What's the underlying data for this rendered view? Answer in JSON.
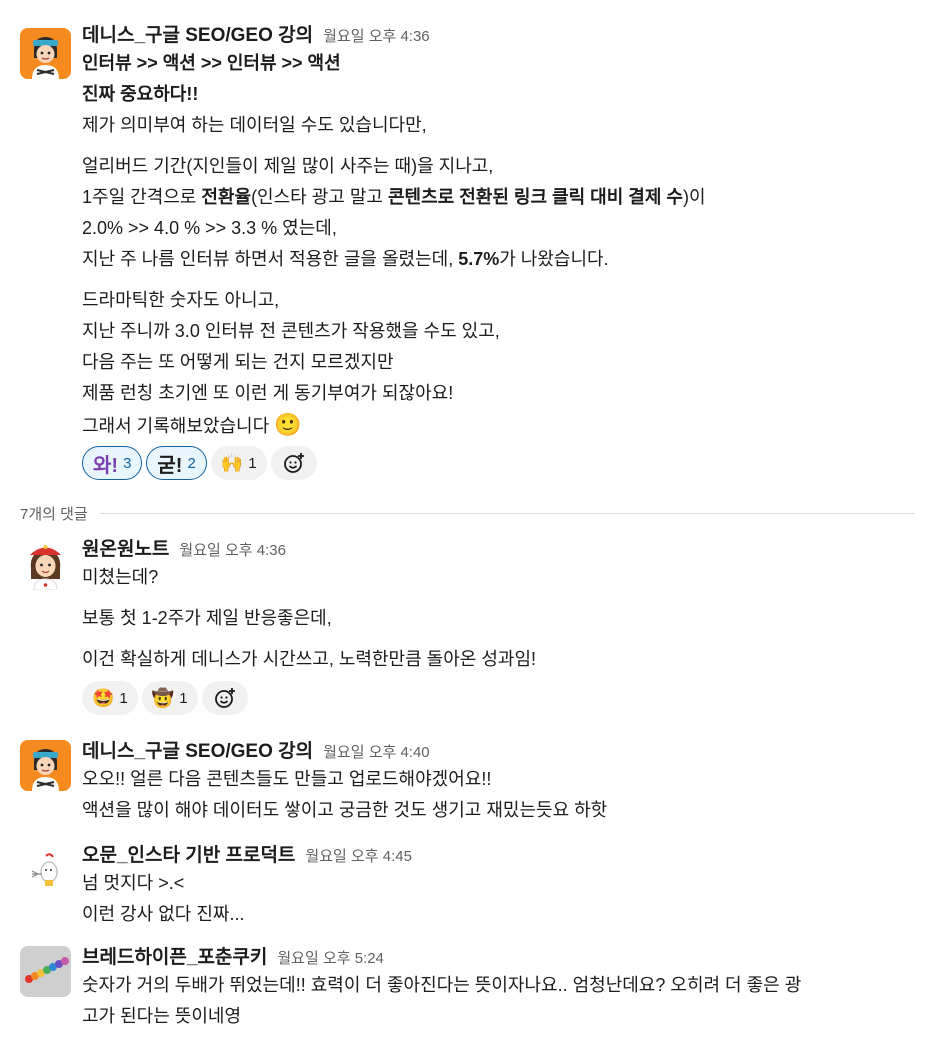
{
  "reactions_main": [
    {
      "emoji": "와!",
      "count": "3"
    },
    {
      "emoji": "굳!",
      "count": "2"
    },
    {
      "emoji": "🙌",
      "count": "1"
    }
  ],
  "messages": [
    {
      "author": "데니스_구글 SEO/GEO 강의",
      "time": "월요일 오후 4:36",
      "lines": {
        "l1": "인터뷰 >> 액션 >> 인터뷰 >> 액션",
        "l2": "진짜 중요하다!!",
        "l3": "제가 의미부여 하는 데이터일 수도 있습니다만,",
        "l4": "얼리버드 기간(지인들이 제일 많이 사주는 때)을 지나고,",
        "l5a": "1주일 간격으로 ",
        "l5b": "전환율",
        "l5c": "(인스타 광고 말고 ",
        "l5d": "콘텐츠로 전환된 링크 클릭 대비 결제 수",
        "l5e": ")이",
        "l6": "2.0% >> 4.0 % >> 3.3 % 였는데,",
        "l7a": "지난 주 나름 인터뷰 하면서 적용한 글을 올렸는데, ",
        "l7b": "5.7%",
        "l7c": "가 나왔습니다.",
        "l8": "드라마틱한 숫자도 아니고,",
        "l9": "지난 주니까 3.0 인터뷰 전 콘텐츠가 작용했을 수도 있고,",
        "l10": "다음 주는 또 어떻게 되는 건지 모르겠지만",
        "l11": "제품 런칭 초기엔 또 이런 게 동기부여가 되잖아요!",
        "l12": "그래서 기록해보았습니다",
        "l12_emoji": "🙂"
      }
    },
    {
      "author": "원온원노트",
      "time": "월요일 오후 4:36",
      "lines": {
        "l1": "미쳤는데?",
        "l2": "보통 첫 1-2주가 제일 반응좋은데,",
        "l3": "이건 확실하게 데니스가 시간쓰고, 노력한만큼 돌아온 성과임!"
      }
    },
    {
      "author": "데니스_구글 SEO/GEO 강의",
      "time": "월요일 오후 4:40",
      "lines": {
        "l1": "오오!! 얼른 다음 콘텐츠들도 만들고 업로드해야겠어요!!",
        "l2": "액션을 많이 해야 데이터도 쌓이고 궁금한 것도 생기고 재밌는듯요 하핫"
      }
    },
    {
      "author": "오문_인스타 기반 프로덕트",
      "time": "월요일 오후 4:45",
      "lines": {
        "l1": "넘 멋지다 >.<",
        "l2": "이런 강사 없다 진짜..."
      }
    },
    {
      "author": "브레드하이픈_포춘쿠키",
      "time": "월요일 오후 5:24",
      "lines": {
        "l1": "숫자가 거의 두배가 뛰었는데!! 효력이 더 좋아진다는 뜻이자나요.. 엄청난데요? 오히려 더 좋은 광",
        "l2": "고가 된다는 뜻이네영"
      }
    }
  ],
  "reply_count_label": "7개의 댓글",
  "reactions_reply": [
    {
      "emoji": "🤩",
      "count": "1"
    },
    {
      "emoji": "🤠",
      "count": "1"
    }
  ]
}
